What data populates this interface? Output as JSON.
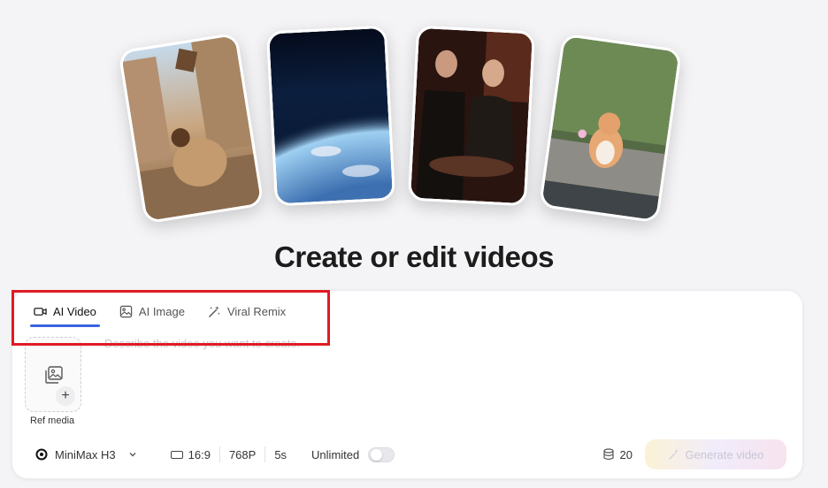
{
  "hero": {
    "title": "Create or edit videos"
  },
  "tabs": [
    {
      "label": "AI Video",
      "icon": "video-camera-icon",
      "active": true
    },
    {
      "label": "AI Image",
      "icon": "image-icon",
      "active": false
    },
    {
      "label": "Viral Remix",
      "icon": "magic-wand-icon",
      "active": false
    }
  ],
  "prompt": {
    "placeholder": "Describe the video you want to create."
  },
  "ref_media": {
    "label": "Ref media"
  },
  "toolbar": {
    "model": "MiniMax H3",
    "aspect_ratio": "16:9",
    "resolution": "768P",
    "duration": "5s",
    "unlimited_label": "Unlimited",
    "unlimited_on": false,
    "credits": "20",
    "generate_label": "Generate video"
  },
  "colors": {
    "accent": "#3b63e0",
    "highlight": "#e01b24"
  }
}
